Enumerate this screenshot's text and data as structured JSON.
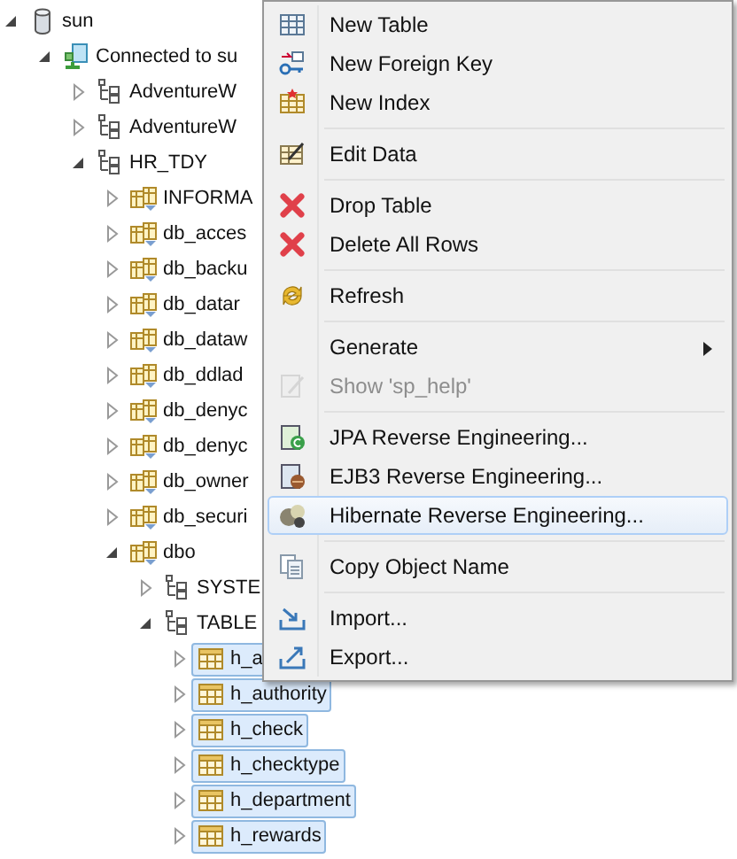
{
  "tree": [
    {
      "label": "sun",
      "kind": "database",
      "expanded": true,
      "selected": false,
      "children": [
        {
          "label": "Connected to su",
          "kind": "connection",
          "expanded": true,
          "selected": false,
          "children": [
            {
              "label": "AdventureW",
              "kind": "schema",
              "expanded": false,
              "selected": false
            },
            {
              "label": "AdventureW",
              "kind": "schema",
              "expanded": false,
              "selected": false
            },
            {
              "label": "HR_TDY",
              "kind": "schema",
              "expanded": true,
              "selected": false,
              "children": [
                {
                  "label": "INFORMA",
                  "kind": "role",
                  "expanded": false,
                  "selected": false
                },
                {
                  "label": "db_acces",
                  "kind": "role",
                  "expanded": false,
                  "selected": false
                },
                {
                  "label": "db_backu",
                  "kind": "role",
                  "expanded": false,
                  "selected": false
                },
                {
                  "label": "db_datar",
                  "kind": "role",
                  "expanded": false,
                  "selected": false
                },
                {
                  "label": "db_dataw",
                  "kind": "role",
                  "expanded": false,
                  "selected": false
                },
                {
                  "label": "db_ddlad",
                  "kind": "role",
                  "expanded": false,
                  "selected": false
                },
                {
                  "label": "db_denyc",
                  "kind": "role",
                  "expanded": false,
                  "selected": false
                },
                {
                  "label": "db_denyc",
                  "kind": "role",
                  "expanded": false,
                  "selected": false
                },
                {
                  "label": "db_owner",
                  "kind": "role",
                  "expanded": false,
                  "selected": false
                },
                {
                  "label": "db_securi",
                  "kind": "role",
                  "expanded": false,
                  "selected": false
                },
                {
                  "label": "dbo",
                  "kind": "role",
                  "expanded": true,
                  "selected": false,
                  "children": [
                    {
                      "label": "SYSTE",
                      "kind": "schema",
                      "expanded": false,
                      "selected": false
                    },
                    {
                      "label": "TABLE",
                      "kind": "schema",
                      "expanded": true,
                      "selected": false,
                      "children": [
                        {
                          "label": "h_a",
                          "kind": "table",
                          "expanded": false,
                          "selected": true
                        },
                        {
                          "label": "h_authority",
                          "kind": "table",
                          "expanded": false,
                          "selected": true
                        },
                        {
                          "label": "h_check",
                          "kind": "table",
                          "expanded": false,
                          "selected": true
                        },
                        {
                          "label": "h_checktype",
                          "kind": "table",
                          "expanded": false,
                          "selected": true
                        },
                        {
                          "label": "h_department",
                          "kind": "table",
                          "expanded": false,
                          "selected": true
                        },
                        {
                          "label": "h_rewards",
                          "kind": "table",
                          "expanded": false,
                          "selected": true
                        }
                      ]
                    }
                  ]
                }
              ]
            }
          ]
        }
      ]
    }
  ],
  "menu": {
    "sections": [
      [
        {
          "label": "New Table",
          "disabled": false,
          "selected": false,
          "submenu": false
        },
        {
          "label": "New Foreign Key",
          "disabled": false,
          "selected": false,
          "submenu": false
        },
        {
          "label": "New Index",
          "disabled": false,
          "selected": false,
          "submenu": false
        }
      ],
      [
        {
          "label": "Edit Data",
          "disabled": false,
          "selected": false,
          "submenu": false
        }
      ],
      [
        {
          "label": "Drop Table",
          "disabled": false,
          "selected": false,
          "submenu": false
        },
        {
          "label": "Delete All Rows",
          "disabled": false,
          "selected": false,
          "submenu": false
        }
      ],
      [
        {
          "label": "Refresh",
          "disabled": false,
          "selected": false,
          "submenu": false
        }
      ],
      [
        {
          "label": "Generate",
          "disabled": false,
          "selected": false,
          "submenu": true
        },
        {
          "label": "Show 'sp_help'",
          "disabled": true,
          "selected": false,
          "submenu": false
        }
      ],
      [
        {
          "label": "JPA Reverse Engineering...",
          "disabled": false,
          "selected": false,
          "submenu": false
        },
        {
          "label": "EJB3 Reverse Engineering...",
          "disabled": false,
          "selected": false,
          "submenu": false
        },
        {
          "label": "Hibernate Reverse Engineering...",
          "disabled": false,
          "selected": true,
          "submenu": false
        }
      ],
      [
        {
          "label": "Copy Object Name",
          "disabled": false,
          "selected": false,
          "submenu": false
        }
      ],
      [
        {
          "label": "Import...",
          "disabled": false,
          "selected": false,
          "submenu": false
        },
        {
          "label": "Export...",
          "disabled": false,
          "selected": false,
          "submenu": false
        }
      ]
    ]
  }
}
